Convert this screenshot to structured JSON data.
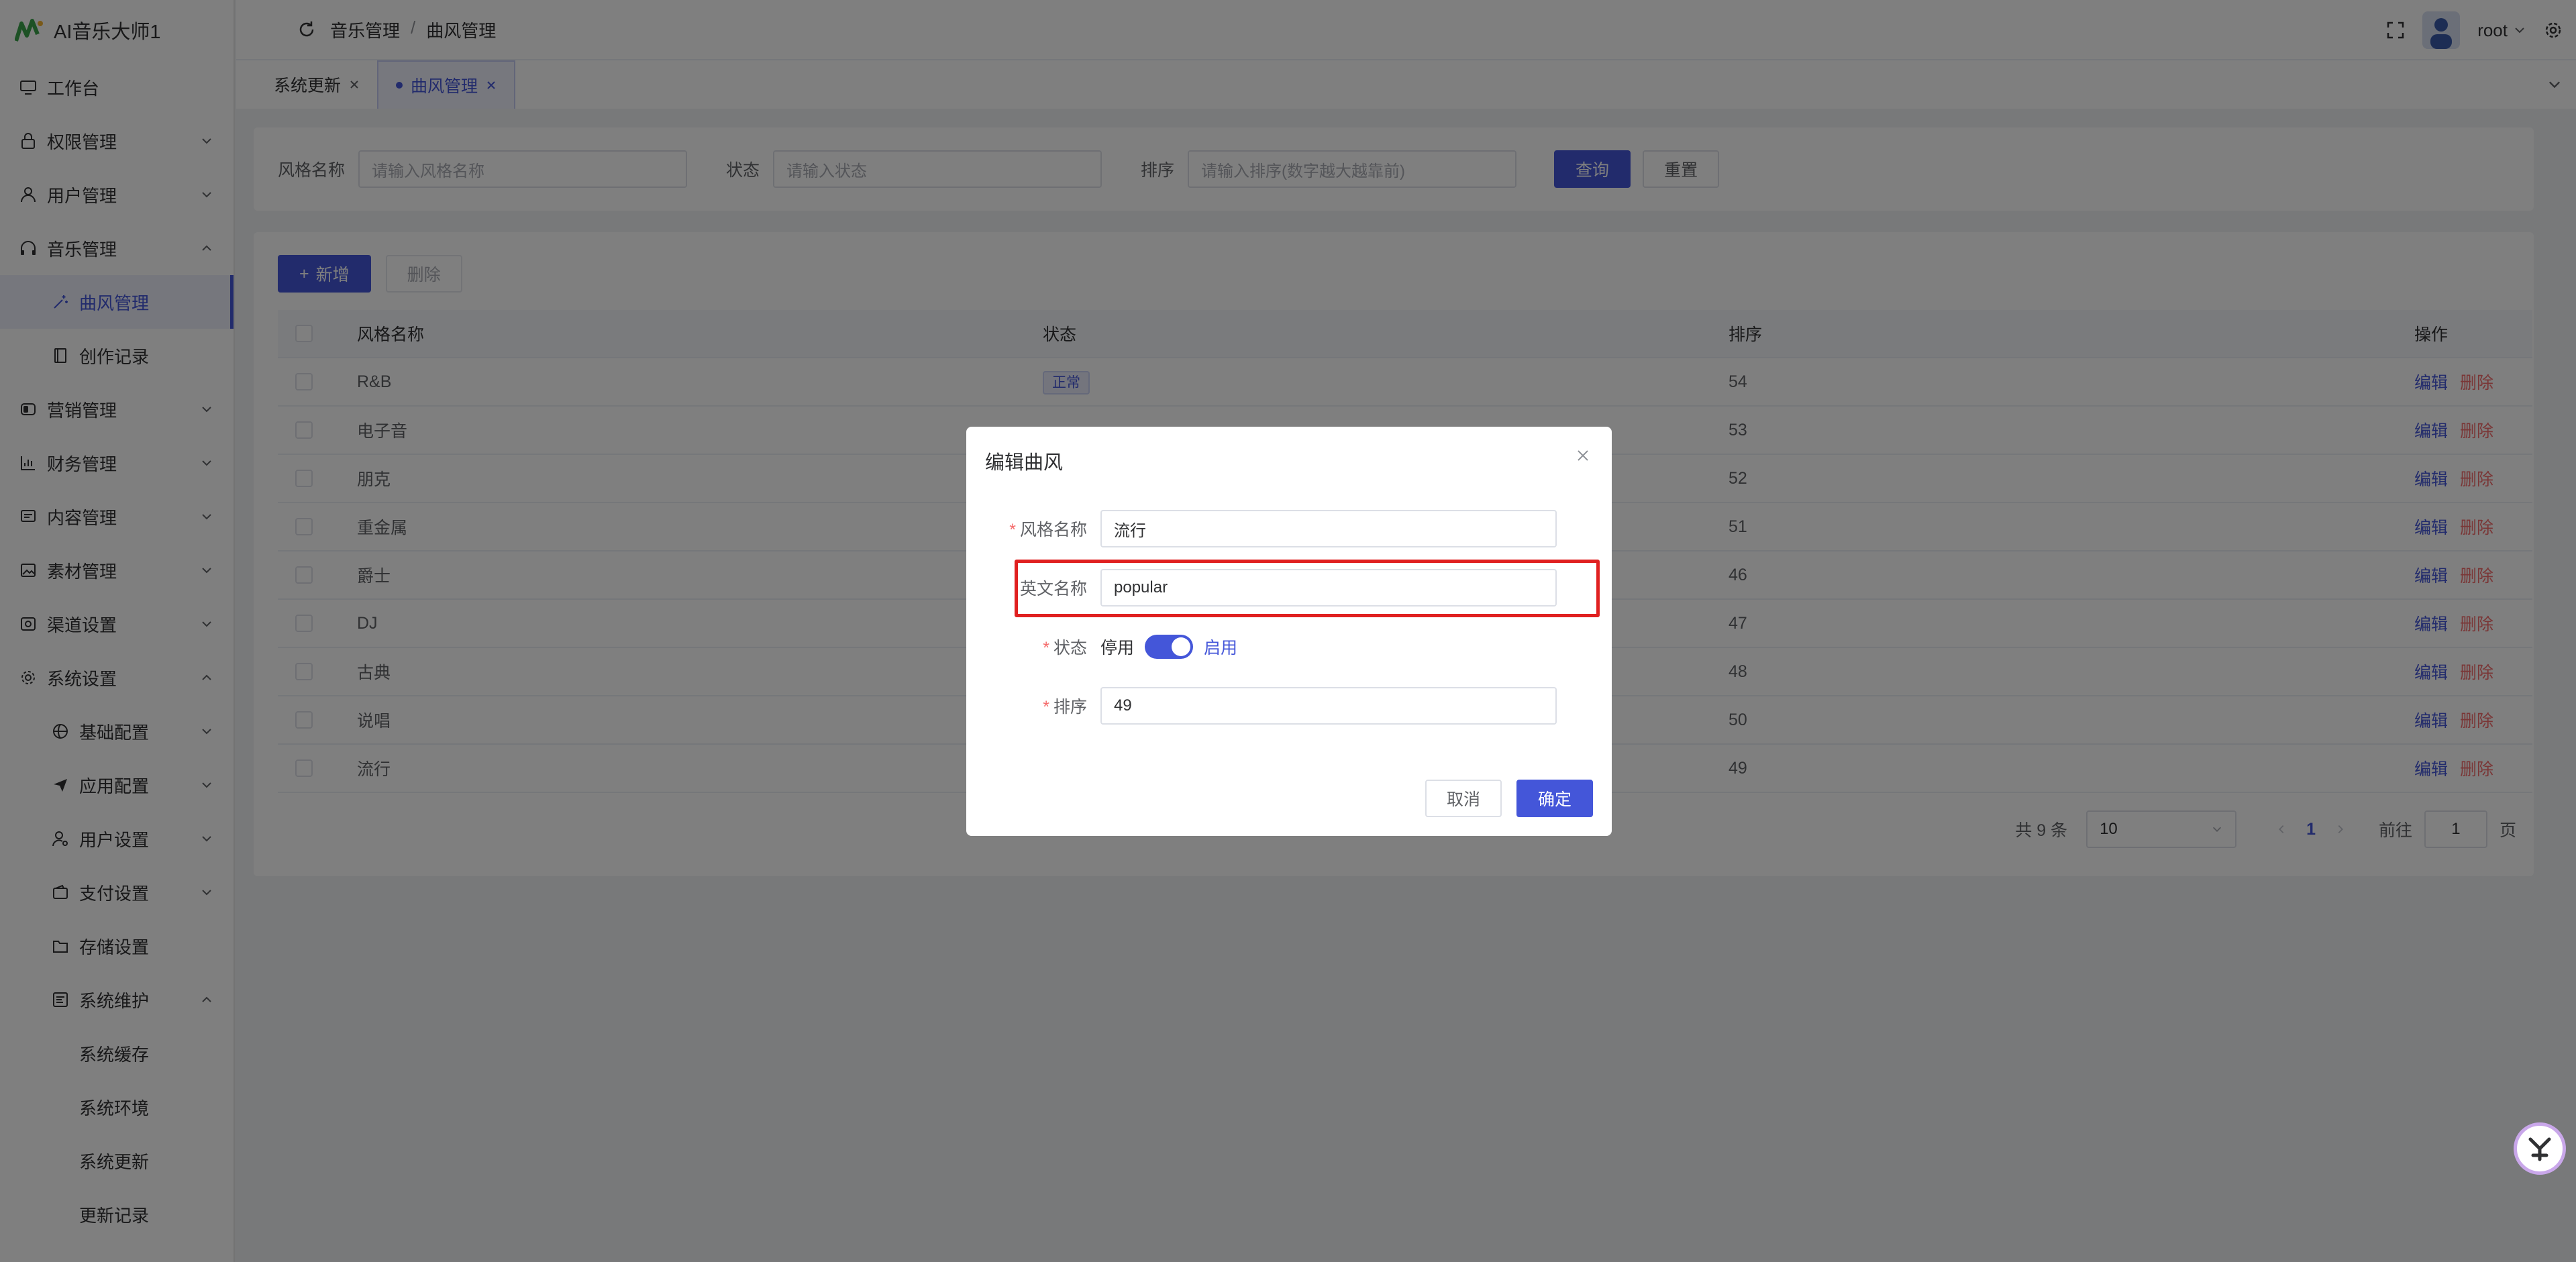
{
  "app": {
    "title": "AI音乐大师1"
  },
  "sidebar": {
    "items": [
      {
        "label": "工作台",
        "icon": "monitor-icon"
      },
      {
        "label": "权限管理",
        "icon": "lock-icon"
      },
      {
        "label": "用户管理",
        "icon": "user-icon"
      },
      {
        "label": "音乐管理",
        "icon": "headphones-icon"
      },
      {
        "label": "曲风管理",
        "icon": "magic-icon",
        "active": true
      },
      {
        "label": "创作记录",
        "icon": "book-icon"
      },
      {
        "label": "营销管理",
        "icon": "switch-icon"
      },
      {
        "label": "财务管理",
        "icon": "chart-icon"
      },
      {
        "label": "内容管理",
        "icon": "message-icon"
      },
      {
        "label": "素材管理",
        "icon": "picture-icon"
      },
      {
        "label": "渠道设置",
        "icon": "camera-icon"
      },
      {
        "label": "系统设置",
        "icon": "gear-icon"
      },
      {
        "label": "基础配置",
        "icon": "basketball-icon"
      },
      {
        "label": "应用配置",
        "icon": "send-icon"
      },
      {
        "label": "用户设置",
        "icon": "user-setting-icon"
      },
      {
        "label": "支付设置",
        "icon": "wallet-icon"
      },
      {
        "label": "存储设置",
        "icon": "folder-icon"
      },
      {
        "label": "系统维护",
        "icon": "maintenance-icon"
      },
      {
        "label": "系统缓存"
      },
      {
        "label": "系统环境"
      },
      {
        "label": "系统更新"
      },
      {
        "label": "更新记录"
      }
    ]
  },
  "header": {
    "breadcrumb": [
      "音乐管理",
      "曲风管理"
    ],
    "separator": "/",
    "username": "root"
  },
  "tabs": [
    {
      "label": "系统更新",
      "active": false
    },
    {
      "label": "曲风管理",
      "active": true
    }
  ],
  "search": {
    "name_label": "风格名称",
    "name_placeholder": "请输入风格名称",
    "status_label": "状态",
    "status_placeholder": "请输入状态",
    "sort_label": "排序",
    "sort_placeholder": "请输入排序(数字越大越靠前)",
    "query_button": "查询",
    "reset_button": "重置"
  },
  "toolbar": {
    "add_button": "新增",
    "delete_button": "删除",
    "add_icon": "+"
  },
  "table": {
    "columns": [
      "风格名称",
      "状态",
      "排序",
      "操作"
    ],
    "rows": [
      {
        "name": "R&B",
        "status": "正常",
        "sort": "54"
      },
      {
        "name": "电子音",
        "status": "",
        "sort": "53"
      },
      {
        "name": "朋克",
        "status": "",
        "sort": "52"
      },
      {
        "name": "重金属",
        "status": "",
        "sort": "51"
      },
      {
        "name": "爵士",
        "status": "",
        "sort": "46"
      },
      {
        "name": "DJ",
        "status": "",
        "sort": "47"
      },
      {
        "name": "古典",
        "status": "",
        "sort": "48"
      },
      {
        "name": "说唱",
        "status": "",
        "sort": "50"
      },
      {
        "name": "流行",
        "status": "",
        "sort": "49"
      }
    ],
    "edit_label": "编辑",
    "delete_label": "删除"
  },
  "pagination": {
    "total_text": "共 9 条",
    "page_size": "10",
    "current_page": "1",
    "goto_label": "前往",
    "goto_value": "1",
    "page_suffix": "页"
  },
  "dialog": {
    "title": "编辑曲风",
    "name_label": "风格名称",
    "name_value": "流行",
    "en_label": "英文名称",
    "en_value": "popular",
    "status_label": "状态",
    "status_off": "停用",
    "status_on": "启用",
    "status_enabled": true,
    "sort_label": "排序",
    "sort_value": "49",
    "cancel_button": "取消",
    "confirm_button": "确定",
    "required_mark": "*"
  },
  "colors": {
    "primary": "#4456d9",
    "danger": "#f56c6c",
    "highlight": "#e02020"
  }
}
